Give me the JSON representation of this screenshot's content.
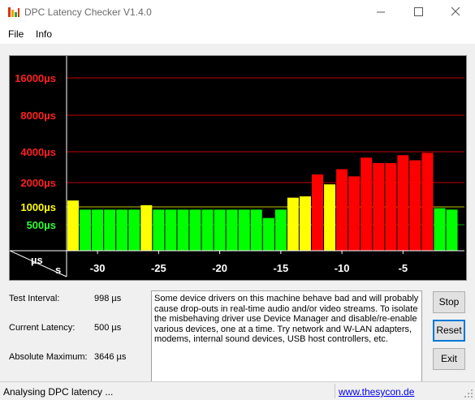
{
  "window": {
    "title": "DPC Latency Checker V1.4.0"
  },
  "menu": {
    "file": "File",
    "info": "Info"
  },
  "chart_data": {
    "type": "bar",
    "y_axis_labels": [
      {
        "label": "16000µs",
        "color": "#ff2020"
      },
      {
        "label": "8000µs",
        "color": "#ff2020"
      },
      {
        "label": "4000µs",
        "color": "#ff2020"
      },
      {
        "label": "2000µs",
        "color": "#ff2020"
      },
      {
        "label": "1000µs",
        "color": "#ffff00"
      },
      {
        "label": "500µs",
        "color": "#30ff30"
      }
    ],
    "corner_labels": {
      "y_unit": "µs",
      "x_unit": "s"
    },
    "x_ticks": [
      "-30",
      "-25",
      "-20",
      "-15",
      "-10",
      "-5"
    ],
    "x_tick_values": [
      -30,
      -25,
      -20,
      -15,
      -10,
      -5
    ],
    "x": [
      -32,
      -31,
      -30,
      -29,
      -28,
      -27,
      -26,
      -25,
      -24,
      -23,
      -22,
      -21,
      -20,
      -19,
      -18,
      -17,
      -16,
      -15,
      -14,
      -13,
      -12,
      -11,
      -10,
      -9,
      -8,
      -7,
      -6,
      -5,
      -4,
      -3,
      -2,
      -1
    ],
    "values": [
      1200,
      900,
      900,
      900,
      900,
      900,
      1050,
      900,
      900,
      900,
      900,
      900,
      900,
      900,
      900,
      900,
      650,
      900,
      1300,
      1350,
      2400,
      1900,
      2700,
      2300,
      3500,
      3100,
      3100,
      3700,
      3300,
      3900,
      950,
      900
    ],
    "secondary_values": {
      "-18": 650,
      "-2": 300
    },
    "colors": {
      "low": "#00ff00",
      "medium": "#ffff00",
      "high": "#ff0000"
    },
    "gridlines_us": [
      500,
      1000,
      2000,
      4000,
      8000,
      16000
    ],
    "grid": true
  },
  "info": {
    "test_interval_label": "Test Interval:",
    "test_interval_value": "998 µs",
    "current_latency_label": "Current Latency:",
    "current_latency_value": "500 µs",
    "absolute_max_label": "Absolute Maximum:",
    "absolute_max_value": "3646 µs"
  },
  "message": "Some device drivers on this machine behave bad and will probably cause drop-outs in real-time audio and/or video streams. To isolate the misbehaving driver use Device Manager and disable/re-enable various devices, one at a time. Try network and W-LAN adapters, modems, internal sound devices, USB host controllers, etc.",
  "buttons": {
    "stop": "Stop",
    "reset": "Reset",
    "exit": "Exit"
  },
  "status": {
    "text": "Analysing DPC latency ...",
    "link": "www.thesycon.de"
  }
}
